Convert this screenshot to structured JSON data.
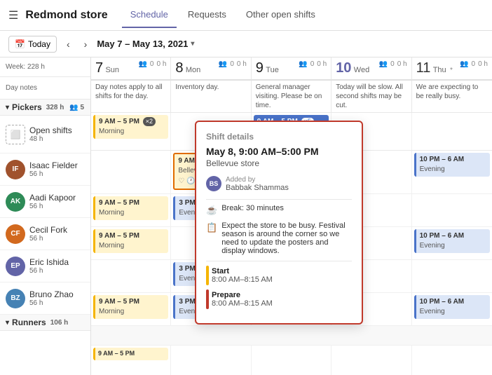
{
  "nav": {
    "hamburger": "≡",
    "title": "Redmond store",
    "tabs": [
      {
        "label": "Schedule",
        "active": true
      },
      {
        "label": "Requests",
        "active": false
      },
      {
        "label": "Other open shifts",
        "active": false
      }
    ]
  },
  "subnav": {
    "today_label": "Today",
    "calendar_icon": "📅",
    "date_range": "May 7 – May 13, 2021",
    "chevron": "▾"
  },
  "sidebar": {
    "week_label": "Week: 228 h",
    "day_notes_label": "Day notes",
    "sections": [
      {
        "name": "Pickers",
        "hours": "328 h",
        "stats": "👥 5",
        "people": [
          {
            "name": "Open shifts",
            "hours": "48 h",
            "is_open": true
          },
          {
            "name": "Isaac Fielder",
            "hours": "56 h",
            "avatar_color": "#a0522d",
            "initials": "IF"
          },
          {
            "name": "Aadi Kapoor",
            "hours": "56 h",
            "avatar_color": "#2e8b57",
            "initials": "AK"
          },
          {
            "name": "Cecil Fork",
            "hours": "56 h",
            "avatar_color": "#d2691e",
            "initials": "CF"
          },
          {
            "name": "Eric Ishida",
            "hours": "56 h",
            "avatar_color": "#6264a7",
            "initials": "EP"
          },
          {
            "name": "Bruno Zhao",
            "hours": "56 h",
            "avatar_color": "#4682b4",
            "initials": "BZ"
          }
        ]
      },
      {
        "name": "Runners",
        "hours": "106 h",
        "stats": ""
      }
    ]
  },
  "days": [
    {
      "number": "7",
      "name": "Sun",
      "stats_people": "0",
      "stats_hours": "0 h"
    },
    {
      "number": "8",
      "name": "Mon",
      "stats_people": "0",
      "stats_hours": "0 h"
    },
    {
      "number": "9",
      "name": "Tue",
      "stats_people": "0",
      "stats_hours": "0 h"
    },
    {
      "number": "10",
      "name": "Wed",
      "stats_people": "0",
      "stats_hours": "0 h",
      "is_today": true
    },
    {
      "number": "11",
      "name": "Thu",
      "stats_people": "0",
      "stats_hours": "0 h"
    }
  ],
  "day_notes": [
    "Day notes apply to all shifts for the day.",
    "Inventory day.",
    "General manager visiting. Please be on time.",
    "Today will be slow. All second shifts may be cut.",
    "We are expecting to be really busy."
  ],
  "popup": {
    "title": "Shift details",
    "date": "May 8, 9:00 AM–5:00 PM",
    "store": "Bellevue store",
    "added_by_label": "Added by",
    "added_by_name": "Babbak Shammas",
    "added_by_initials": "BS",
    "break_label": "Break: 30 minutes",
    "break_icon": "☕",
    "note_icon": "📋",
    "note_text": "Expect the store to be busy. Festival season is around the corner so we need to update the posters and display windows.",
    "segments": [
      {
        "color": "#f5b400",
        "label": "Start",
        "time": "8:00 AM–8:15 AM"
      },
      {
        "color": "#c0392b",
        "label": "Prepare",
        "time": "8:00 AM–8:15 AM"
      }
    ]
  },
  "shifts": {
    "open_shifts": [
      {
        "day": 0,
        "time": "9 AM – 5 PM",
        "label": "Morning",
        "type": "yellow",
        "badge": "×2"
      },
      {
        "day": 1,
        "time": "",
        "label": "",
        "type": "empty"
      },
      {
        "day": 2,
        "time": "9 AM – 5 PM",
        "label": "All day",
        "type": "blue-allday",
        "badge": "×5"
      },
      {
        "day": 3,
        "time": "",
        "label": "",
        "type": "empty"
      },
      {
        "day": 4,
        "time": "",
        "label": "",
        "type": "empty"
      }
    ],
    "isaac": [
      {
        "day": 0,
        "time": "",
        "type": "empty"
      },
      {
        "day": 1,
        "time": "9 AM–5 PM",
        "label": "Bellevue store",
        "type": "orange-border",
        "has_icons": true
      },
      {
        "day": 2,
        "time": "",
        "type": "empty"
      },
      {
        "day": 3,
        "time": "",
        "type": "empty"
      },
      {
        "day": 4,
        "time": "10 PM – 6 AM",
        "label": "Evening",
        "type": "blue"
      }
    ],
    "aadi": [
      {
        "day": 0,
        "time": "9 AM – 5 PM",
        "label": "Morning",
        "type": "yellow"
      },
      {
        "day": 1,
        "time": "3 PM – 11 PM",
        "label": "Evening",
        "type": "blue"
      },
      {
        "day": 2,
        "time": "",
        "type": "empty"
      },
      {
        "day": 3,
        "time": "",
        "type": "empty"
      },
      {
        "day": 4,
        "time": "",
        "type": "empty"
      }
    ],
    "cecil": [
      {
        "day": 0,
        "time": "9 AM – 5 PM",
        "label": "Morning",
        "type": "yellow"
      },
      {
        "day": 1,
        "time": "",
        "type": "empty"
      },
      {
        "day": 2,
        "time": "",
        "type": "empty"
      },
      {
        "day": 3,
        "time": "",
        "type": "empty"
      },
      {
        "day": 4,
        "time": "10 PM – 6 AM",
        "label": "Evening",
        "type": "blue"
      }
    ],
    "eric": [
      {
        "day": 0,
        "time": "",
        "type": "empty"
      },
      {
        "day": 1,
        "time": "3 PM – 11 PM",
        "label": "Evening",
        "type": "blue"
      },
      {
        "day": 2,
        "time": "",
        "type": "empty"
      },
      {
        "day": 3,
        "time": "",
        "type": "empty"
      },
      {
        "day": 4,
        "time": "",
        "type": "empty"
      }
    ],
    "bruno": [
      {
        "day": 0,
        "time": "9 AM – 5 PM",
        "label": "Morning",
        "type": "yellow"
      },
      {
        "day": 1,
        "time": "3 PM – 11 PM",
        "label": "Evening",
        "type": "blue"
      },
      {
        "day": 2,
        "time": "",
        "type": "empty"
      },
      {
        "day": 3,
        "time": "",
        "type": "empty"
      },
      {
        "day": 4,
        "time": "10 PM – 6 AM",
        "label": "Evening",
        "type": "blue"
      }
    ]
  }
}
